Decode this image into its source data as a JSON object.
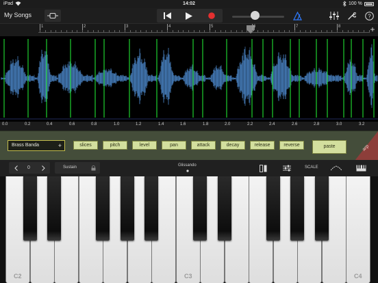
{
  "status_bar": {
    "carrier": "iPad",
    "clock": "14:02",
    "battery": "100 %"
  },
  "toolbar": {
    "my_songs": "My Songs"
  },
  "ruler": {
    "bars": [
      "1",
      "2",
      "3",
      "4",
      "5",
      "6",
      "7",
      "8"
    ]
  },
  "waveform": {
    "time_labels": [
      "0.0",
      "0.2",
      "0.4",
      "0.6",
      "0.8",
      "1.0",
      "1.2",
      "1.4",
      "1.6",
      "1.8",
      "2.0",
      "2.2",
      "2.4",
      "2.6",
      "2.8",
      "3.0",
      "3.2"
    ],
    "slice_marker_color": "#1fd12f",
    "wave_color": "#4f8ed4"
  },
  "controls": {
    "preset_name": "Brass Banda",
    "preset_add": "+",
    "buttons": [
      "slices",
      "pitch",
      "level",
      "pan",
      "attack",
      "decay",
      "release",
      "reverse"
    ],
    "paste": "paste",
    "arp": "arp"
  },
  "keyboard_header": {
    "octave": "0",
    "sustain": "Sustain",
    "glissando": "Glissando",
    "scale": "SCALE"
  },
  "keyboard": {
    "note_labels": [
      "C2",
      "C3",
      "C4"
    ]
  }
}
